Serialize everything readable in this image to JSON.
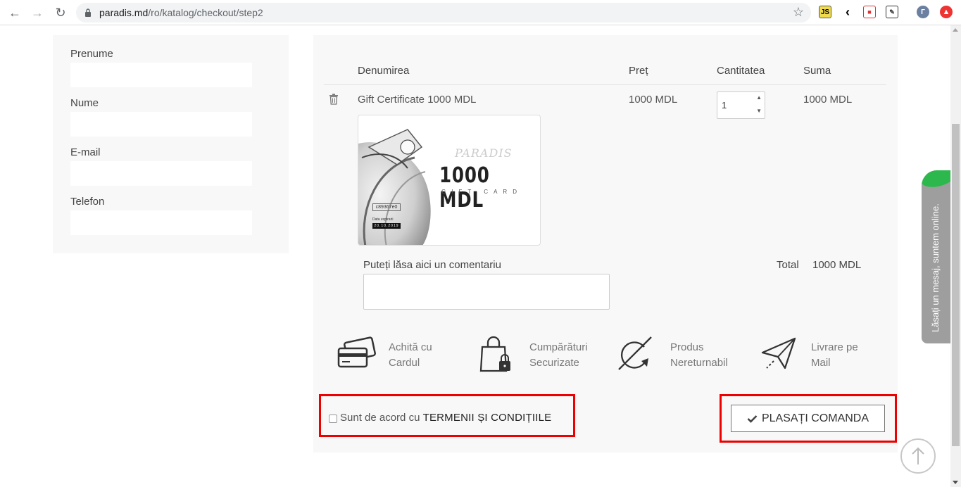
{
  "browser": {
    "url_host": "paradis.md",
    "url_path": "/ro/katalog/checkout/step2",
    "avatar_letter": "Г"
  },
  "form": {
    "fields": [
      {
        "label": "Prenume",
        "value": ""
      },
      {
        "label": "Nume",
        "value": ""
      },
      {
        "label": "E-mail",
        "value": ""
      },
      {
        "label": "Telefon",
        "value": ""
      }
    ]
  },
  "cart": {
    "headers": {
      "name": "Denumirea",
      "price": "Preț",
      "quantity": "Cantitatea",
      "sum": "Suma"
    },
    "item": {
      "name": "Gift Certificate 1000 MDL",
      "price": "1000 MDL",
      "quantity": "1",
      "sum": "1000 MDL",
      "card": {
        "brand": "PARADIS",
        "amount": "1000 MDL",
        "subtitle": "GIFT CARD",
        "code": "c89367e0",
        "expiry_label": "Data expirarii",
        "expiry": "20.10.2019"
      }
    },
    "comment_label": "Puteți lăsa aici un comentariu",
    "comment_value": "",
    "total_label": "Total",
    "total_value": "1000 MDL"
  },
  "features": [
    {
      "icon": "credit-card-icon",
      "line1": "Achită cu",
      "line2": "Cardul"
    },
    {
      "icon": "shopping-bag-lock-icon",
      "line1": "Cumpărături",
      "line2": "Securizate"
    },
    {
      "icon": "no-return-icon",
      "line1": "Produs",
      "line2": "Nereturnabil"
    },
    {
      "icon": "paper-plane-icon",
      "line1": "Livrare pe",
      "line2": "Mail"
    }
  ],
  "terms": {
    "prefix": "Sunt de acord cu ",
    "link": "TERMENII ȘI CONDIȚIILE",
    "checked": false
  },
  "order_button": {
    "label": "PLASAȚI COMANDA"
  },
  "chat": {
    "label": "Lăsați un mesaj, suntem online."
  },
  "colors": {
    "highlight": "#e00000",
    "chat_green": "#2db84d",
    "chat_gray": "#9e9e9e"
  }
}
